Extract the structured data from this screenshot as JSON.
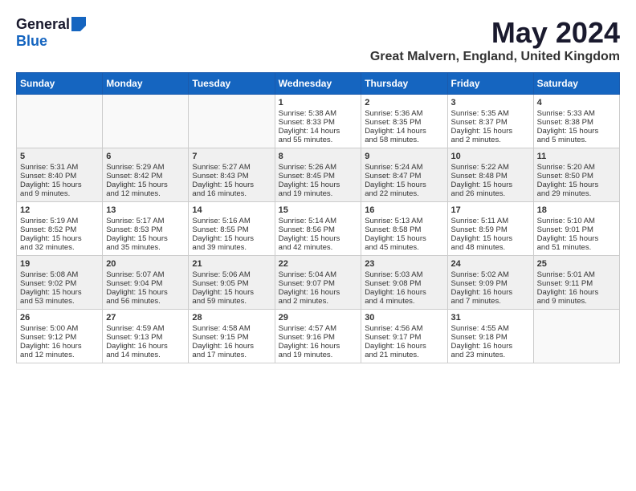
{
  "logo": {
    "general": "General",
    "blue": "Blue"
  },
  "title": "May 2024",
  "location": "Great Malvern, England, United Kingdom",
  "headers": [
    "Sunday",
    "Monday",
    "Tuesday",
    "Wednesday",
    "Thursday",
    "Friday",
    "Saturday"
  ],
  "weeks": [
    {
      "days": [
        {
          "num": "",
          "data": ""
        },
        {
          "num": "",
          "data": ""
        },
        {
          "num": "",
          "data": ""
        },
        {
          "num": "1",
          "data": "Sunrise: 5:38 AM\nSunset: 8:33 PM\nDaylight: 14 hours\nand 55 minutes."
        },
        {
          "num": "2",
          "data": "Sunrise: 5:36 AM\nSunset: 8:35 PM\nDaylight: 14 hours\nand 58 minutes."
        },
        {
          "num": "3",
          "data": "Sunrise: 5:35 AM\nSunset: 8:37 PM\nDaylight: 15 hours\nand 2 minutes."
        },
        {
          "num": "4",
          "data": "Sunrise: 5:33 AM\nSunset: 8:38 PM\nDaylight: 15 hours\nand 5 minutes."
        }
      ]
    },
    {
      "days": [
        {
          "num": "5",
          "data": "Sunrise: 5:31 AM\nSunset: 8:40 PM\nDaylight: 15 hours\nand 9 minutes."
        },
        {
          "num": "6",
          "data": "Sunrise: 5:29 AM\nSunset: 8:42 PM\nDaylight: 15 hours\nand 12 minutes."
        },
        {
          "num": "7",
          "data": "Sunrise: 5:27 AM\nSunset: 8:43 PM\nDaylight: 15 hours\nand 16 minutes."
        },
        {
          "num": "8",
          "data": "Sunrise: 5:26 AM\nSunset: 8:45 PM\nDaylight: 15 hours\nand 19 minutes."
        },
        {
          "num": "9",
          "data": "Sunrise: 5:24 AM\nSunset: 8:47 PM\nDaylight: 15 hours\nand 22 minutes."
        },
        {
          "num": "10",
          "data": "Sunrise: 5:22 AM\nSunset: 8:48 PM\nDaylight: 15 hours\nand 26 minutes."
        },
        {
          "num": "11",
          "data": "Sunrise: 5:20 AM\nSunset: 8:50 PM\nDaylight: 15 hours\nand 29 minutes."
        }
      ]
    },
    {
      "days": [
        {
          "num": "12",
          "data": "Sunrise: 5:19 AM\nSunset: 8:52 PM\nDaylight: 15 hours\nand 32 minutes."
        },
        {
          "num": "13",
          "data": "Sunrise: 5:17 AM\nSunset: 8:53 PM\nDaylight: 15 hours\nand 35 minutes."
        },
        {
          "num": "14",
          "data": "Sunrise: 5:16 AM\nSunset: 8:55 PM\nDaylight: 15 hours\nand 39 minutes."
        },
        {
          "num": "15",
          "data": "Sunrise: 5:14 AM\nSunset: 8:56 PM\nDaylight: 15 hours\nand 42 minutes."
        },
        {
          "num": "16",
          "data": "Sunrise: 5:13 AM\nSunset: 8:58 PM\nDaylight: 15 hours\nand 45 minutes."
        },
        {
          "num": "17",
          "data": "Sunrise: 5:11 AM\nSunset: 8:59 PM\nDaylight: 15 hours\nand 48 minutes."
        },
        {
          "num": "18",
          "data": "Sunrise: 5:10 AM\nSunset: 9:01 PM\nDaylight: 15 hours\nand 51 minutes."
        }
      ]
    },
    {
      "days": [
        {
          "num": "19",
          "data": "Sunrise: 5:08 AM\nSunset: 9:02 PM\nDaylight: 15 hours\nand 53 minutes."
        },
        {
          "num": "20",
          "data": "Sunrise: 5:07 AM\nSunset: 9:04 PM\nDaylight: 15 hours\nand 56 minutes."
        },
        {
          "num": "21",
          "data": "Sunrise: 5:06 AM\nSunset: 9:05 PM\nDaylight: 15 hours\nand 59 minutes."
        },
        {
          "num": "22",
          "data": "Sunrise: 5:04 AM\nSunset: 9:07 PM\nDaylight: 16 hours\nand 2 minutes."
        },
        {
          "num": "23",
          "data": "Sunrise: 5:03 AM\nSunset: 9:08 PM\nDaylight: 16 hours\nand 4 minutes."
        },
        {
          "num": "24",
          "data": "Sunrise: 5:02 AM\nSunset: 9:09 PM\nDaylight: 16 hours\nand 7 minutes."
        },
        {
          "num": "25",
          "data": "Sunrise: 5:01 AM\nSunset: 9:11 PM\nDaylight: 16 hours\nand 9 minutes."
        }
      ]
    },
    {
      "days": [
        {
          "num": "26",
          "data": "Sunrise: 5:00 AM\nSunset: 9:12 PM\nDaylight: 16 hours\nand 12 minutes."
        },
        {
          "num": "27",
          "data": "Sunrise: 4:59 AM\nSunset: 9:13 PM\nDaylight: 16 hours\nand 14 minutes."
        },
        {
          "num": "28",
          "data": "Sunrise: 4:58 AM\nSunset: 9:15 PM\nDaylight: 16 hours\nand 17 minutes."
        },
        {
          "num": "29",
          "data": "Sunrise: 4:57 AM\nSunset: 9:16 PM\nDaylight: 16 hours\nand 19 minutes."
        },
        {
          "num": "30",
          "data": "Sunrise: 4:56 AM\nSunset: 9:17 PM\nDaylight: 16 hours\nand 21 minutes."
        },
        {
          "num": "31",
          "data": "Sunrise: 4:55 AM\nSunset: 9:18 PM\nDaylight: 16 hours\nand 23 minutes."
        },
        {
          "num": "",
          "data": ""
        }
      ]
    }
  ]
}
